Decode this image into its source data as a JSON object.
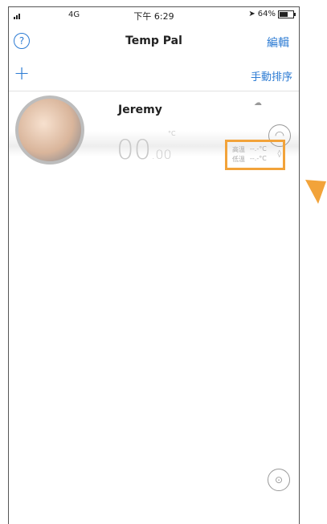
{
  "status_bar": {
    "carrier": "4G",
    "time": "下午 6:29",
    "battery": "64%",
    "battery_level": 0.64
  },
  "nav": {
    "title": "Temp Pal",
    "edit_label": "編輯",
    "help_icon": "help-circle-icon"
  },
  "toolbar": {
    "add_icon": "plus-icon",
    "sort_label": "手動排序"
  },
  "device": {
    "name": "Jeremy",
    "temp_int": "00",
    "temp_dec": ".00",
    "unit": "°C",
    "high_label": "高溫",
    "high_value": "--.-°C",
    "low_label": "低溫",
    "low_value": "--.-°C"
  },
  "colors": {
    "accent": "#2c7bd3",
    "highlight": "#f2a33a"
  }
}
